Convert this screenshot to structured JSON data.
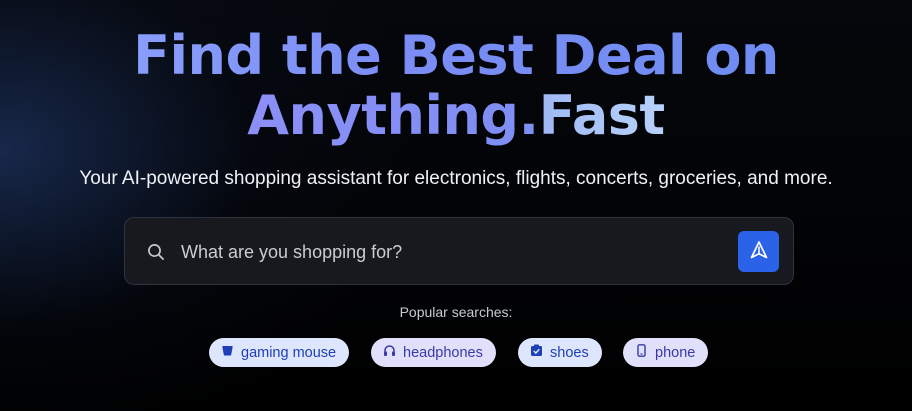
{
  "hero": {
    "headline_line1": "Find the Best Deal on",
    "headline_line2a": "Anything.",
    "headline_line2b": "Fast",
    "tagline": "Your AI-powered shopping assistant for electronics, flights, concerts, groceries, and more."
  },
  "search": {
    "placeholder": "What are you shopping for?",
    "value": "",
    "icon": "search-icon",
    "submit_icon": "send-arrow-icon",
    "submit_color": "#2a63e8"
  },
  "popular": {
    "label": "Popular searches:",
    "chips": [
      {
        "label": "gaming mouse",
        "icon": "mouse-icon"
      },
      {
        "label": "headphones",
        "icon": "headphones-icon"
      },
      {
        "label": "shoes",
        "icon": "shoebox-icon"
      },
      {
        "label": "phone",
        "icon": "phone-icon"
      }
    ]
  },
  "colors": {
    "accent": "#2a63e8",
    "chip_bg": "#dde6fc",
    "chip_text": "#1f3fb6"
  }
}
